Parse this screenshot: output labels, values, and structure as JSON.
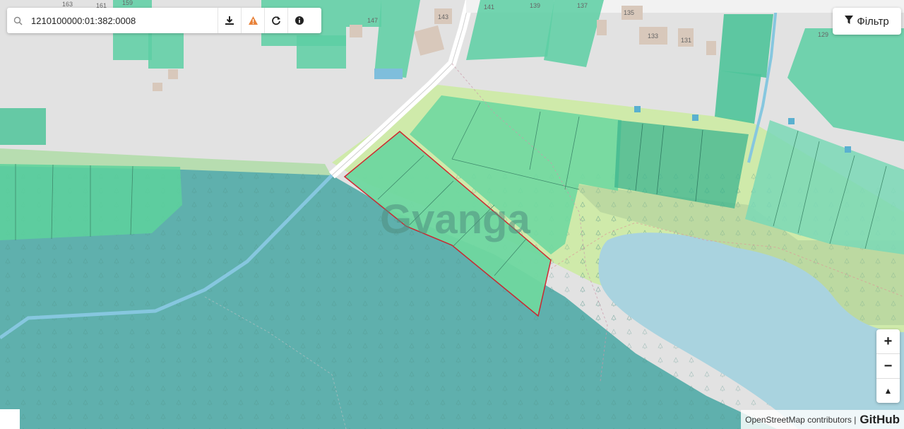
{
  "search": {
    "value": "1210100000:01:382:0008"
  },
  "toolbar": {
    "download_icon": "download-icon",
    "warning_icon": "warning-icon",
    "refresh_icon": "refresh-icon",
    "info_icon": "info-icon"
  },
  "filter": {
    "label": "Фільтр",
    "icon": "filter-icon"
  },
  "zoom": {
    "in_label": "+",
    "out_label": "−",
    "reset_label": "▲"
  },
  "attribution": {
    "osm": "OpenStreetMap contributors |",
    "github": "GitHub"
  },
  "watermark": "Gvanga",
  "house_numbers": [
    "163",
    "161",
    "159",
    "147",
    "143",
    "141",
    "139",
    "137",
    "135",
    "133",
    "131",
    "129"
  ],
  "colors": {
    "parcel_green": "#6fd8a0",
    "forest": "#5aaeae",
    "water": "#a9d3df",
    "meadow": "#cfeaaa",
    "highlight_border": "#d0202a"
  }
}
